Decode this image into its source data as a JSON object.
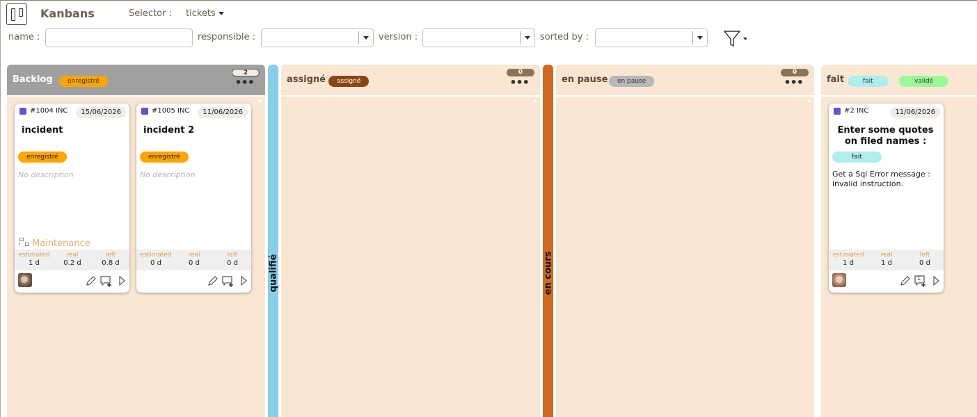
{
  "header": {
    "title": "Kanbans",
    "selector_label": "Selector :",
    "selector_value": "tickets"
  },
  "filters": {
    "name_label": "name :",
    "name_value": "",
    "responsible_label": "responsible :",
    "responsible_value": "",
    "version_label": "version :",
    "version_value": "",
    "sorted_label": "sorted by :",
    "sorted_value": ""
  },
  "columns": [
    {
      "title": "Backlog",
      "count": "2",
      "badges": [
        {
          "label": "enregistré",
          "color": "#ffa500"
        }
      ],
      "cards": [
        {
          "id": "#1004 INC",
          "date": "15/06/2026",
          "title": "incident",
          "status": "enregistré",
          "status_color": "#ffa500",
          "description": "No description",
          "project": "Maintenance",
          "estimated_label": "estimated",
          "real_label": "real",
          "left_label": "left",
          "estimated": "1 d",
          "real": "0.2 d",
          "left": "0.8 d"
        },
        {
          "id": "#1005 INC",
          "date": "11/06/2026",
          "title": "incident 2",
          "status": "enregistré",
          "status_color": "#ffa500",
          "description": "No description",
          "estimated_label": "estimated",
          "real_label": "real",
          "left_label": "left",
          "estimated": "0 d",
          "real": "0 d",
          "left": "0 d"
        }
      ]
    },
    {
      "title": "assigné",
      "count": "0",
      "badges": [
        {
          "label": "assigné",
          "color": "#8b4513"
        }
      ],
      "cards": []
    },
    {
      "title": "en pause",
      "count": "0",
      "badges": [
        {
          "label": "en pause",
          "color": "#b8b8b8"
        }
      ],
      "cards": []
    },
    {
      "title": "fait",
      "badges": [
        {
          "label": "fait",
          "color": "#aeeeee"
        },
        {
          "label": "validé",
          "color": "#98fb98"
        }
      ],
      "cards": [
        {
          "id": "#2 INC",
          "date": "11/06/2026",
          "title": "Enter some quotes on filed names :",
          "status": "fait",
          "status_color": "#aeeeee",
          "description": "Get a Sql Error message : invalid instruction.",
          "estimated_label": "estimated",
          "real_label": "real",
          "left_label": "left",
          "estimated": "1 d",
          "real": "1 d",
          "left": "0 d",
          "comment_count": "1"
        }
      ]
    }
  ],
  "collapsed_columns": [
    {
      "title": "qualifié",
      "color": "#87ceeb"
    },
    {
      "title": "en cours",
      "color": "#d2691e"
    }
  ],
  "icons": [
    "kanban-logo-icon",
    "caret-down-icon",
    "filter-icon",
    "dots-menu-icon",
    "edit-icon",
    "add-comment-icon",
    "play-icon",
    "hierarchy-icon"
  ]
}
